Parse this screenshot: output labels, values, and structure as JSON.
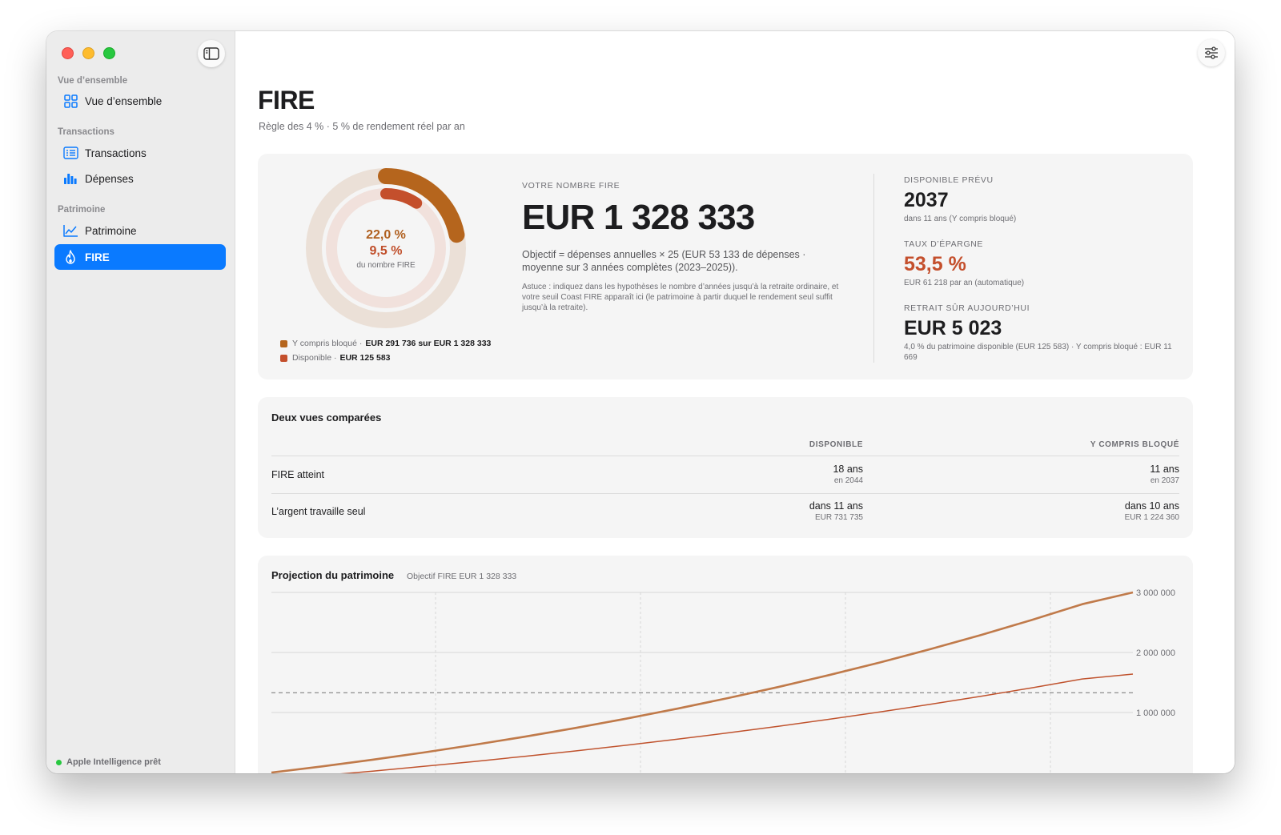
{
  "colors": {
    "accent": "#0a7aff",
    "incl_blocked": "#b5651d",
    "available": "#c44f2c",
    "ring_track_outer": "#ebe0d7",
    "ring_track_inner": "#f1e1dc"
  },
  "sidebar": {
    "sections": [
      {
        "title": "Vue d’ensemble"
      },
      {
        "title": "Transactions"
      },
      {
        "title": "Patrimoine"
      }
    ],
    "items": [
      {
        "label": "Vue d’ensemble",
        "icon": "grid-icon"
      },
      {
        "label": "Transactions",
        "icon": "list-icon"
      },
      {
        "label": "Dépenses",
        "icon": "bar-chart-icon"
      },
      {
        "label": "Patrimoine",
        "icon": "line-chart-icon"
      },
      {
        "label": "FIRE",
        "icon": "flame-icon",
        "active": true
      }
    ],
    "status": "Apple Intelligence prêt"
  },
  "header": {
    "title": "FIRE",
    "subtitle": "Règle des 4 % · 5 % de rendement réel par an"
  },
  "progress": {
    "incl_blocked_pct": 22.0,
    "available_pct": 9.5,
    "incl_blocked_label": "22,0 %",
    "available_label": "9,5 %",
    "caption": "du nombre FIRE",
    "legend": [
      {
        "label": "Y compris bloqué ·",
        "value": "EUR 291 736 sur EUR 1 328 333"
      },
      {
        "label": "Disponible ·",
        "value": "EUR 125 583"
      }
    ]
  },
  "fire": {
    "label": "VOTRE NOMBRE FIRE",
    "amount": "EUR 1 328 333",
    "description": "Objectif = dépenses annuelles × 25 (EUR 53 133 de dépenses · moyenne sur 3 années complètes (2023–2025)).",
    "tip": "Astuce : indiquez dans les hypothèses le nombre d’années jusqu’à la retraite ordinaire, et votre seuil Coast FIRE apparaît ici (le patrimoine à partir duquel le rendement seul suffit jusqu’à la retraite)."
  },
  "stats": [
    {
      "label": "DISPONIBLE PRÉVU",
      "value": "2037",
      "note": "dans 11 ans (Y compris bloqué)"
    },
    {
      "label": "TAUX D’ÉPARGNE",
      "value": "53,5 %",
      "note": "EUR 61 218 par an (automatique)"
    },
    {
      "label": "RETRAIT SÛR AUJOURD’HUI",
      "value": "EUR 5 023",
      "note": "4,0 % du patrimoine disponible (EUR 125 583) · Y compris bloqué : EUR 11 669"
    }
  ],
  "comparison": {
    "title": "Deux vues comparées",
    "columns": [
      "DISPONIBLE",
      "Y COMPRIS BLOQUÉ"
    ],
    "rows": [
      {
        "label": "FIRE atteint",
        "available": {
          "value": "18 ans",
          "sub": "en 2044"
        },
        "blocked": {
          "value": "11 ans",
          "sub": "en 2037"
        }
      },
      {
        "label": "L’argent travaille seul",
        "available": {
          "value": "dans 11 ans",
          "sub": "EUR 731 735"
        },
        "blocked": {
          "value": "dans 10 ans",
          "sub": "EUR 1 224 360"
        }
      }
    ]
  },
  "projection": {
    "title": "Projection du patrimoine",
    "subtitle": "Objectif FIRE EUR 1 328 333"
  },
  "chart_data": {
    "type": "line",
    "title": "Projection du patrimoine",
    "x": [
      0,
      1,
      2,
      3,
      4,
      5,
      6,
      7,
      8,
      9,
      10,
      11,
      12,
      13,
      14,
      15,
      16,
      17,
      18,
      19,
      20,
      21
    ],
    "series": [
      {
        "values": [
          0,
          103000,
          214000,
          333000,
          461000,
          597000,
          742000,
          897000,
          1062000,
          1238000,
          1424000,
          1622000,
          1832000,
          2054000,
          2290000,
          2540000,
          2804000,
          3000000,
          3000000,
          3000000,
          3000000,
          3000000
        ],
        "color": "#c07a4a",
        "width": 2.6
      },
      {
        "values": [
          -120000,
          -50000,
          24000,
          102000,
          184000,
          270000,
          360000,
          455000,
          555000,
          660000,
          770000,
          886000,
          1008000,
          1136000,
          1270000,
          1411000,
          1559000,
          1640000,
          1640000,
          1640000,
          1640000,
          1640000
        ],
        "color": "#c0532e",
        "width": 1.5
      }
    ],
    "target": 1328333,
    "yticks": [
      1000000,
      2000000,
      3000000
    ],
    "ytick_labels": [
      "1 000 000",
      "2 000 000",
      "3 000 000"
    ],
    "ylim": [
      0,
      3000000
    ],
    "grid": true
  }
}
